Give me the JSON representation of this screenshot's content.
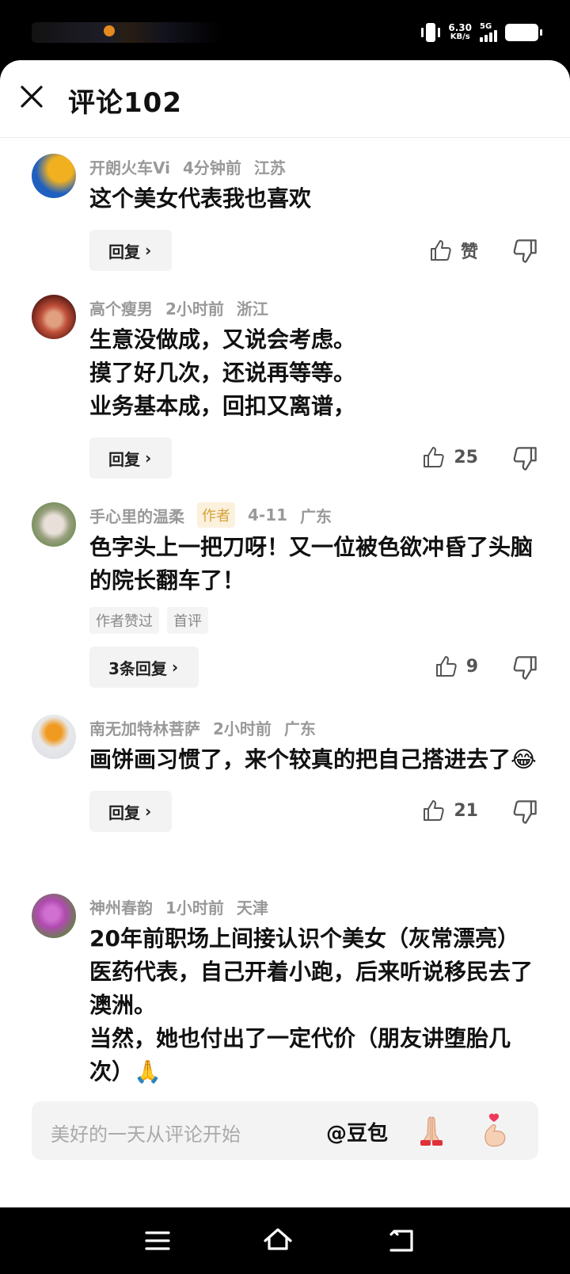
{
  "status_bar": {
    "net_speed": "6.30",
    "net_unit": "KB/s",
    "network": "5G"
  },
  "header": {
    "title": "评论102"
  },
  "comments": [
    {
      "name": "开朗火车Vi",
      "time": "4分钟前",
      "location": "江苏",
      "text": "这个美女代表我也喜欢",
      "reply_label": "回复",
      "likes": "赞",
      "avatar_colors": [
        "#1f5fc0",
        "#f0b020"
      ]
    },
    {
      "name": "高个瘦男",
      "time": "2小时前",
      "location": "浙江",
      "text": "生意没做成，又说会考虑。\n摸了好几次，还说再等等。\n业务基本成，回扣又离谱，",
      "reply_label": "回复",
      "likes": "25",
      "avatar_colors": [
        "#5a1a14",
        "#c0503a"
      ]
    },
    {
      "name": "手心里的温柔",
      "author_tag": "作者",
      "time": "4-11",
      "location": "广东",
      "text": "色字头上一把刀呀！又一位被色欲冲昏了头脑的院长翻车了！",
      "tags": [
        "作者赞过",
        "首评"
      ],
      "reply_label": "3条回复",
      "likes": "9",
      "avatar_colors": [
        "#6a8a50",
        "#e8e0d8"
      ]
    },
    {
      "name": "南无加特林菩萨",
      "time": "2小时前",
      "location": "广东",
      "text": "画饼画习惯了，来个较真的把自己搭进去了",
      "emoji": "😂",
      "reply_label": "回复",
      "likes": "21",
      "avatar_colors": [
        "#e0e4ea",
        "#f09a20"
      ]
    },
    {
      "name": "神州春韵",
      "time": "1小时前",
      "location": "天津",
      "text": "20年前职场上间接认识个美女（灰常漂亮）医药代表，自己开着小跑，后来听说移民去了澳洲。\n当然，她也付出了一定代价（朋友讲堕胎几次）",
      "emoji": "🙏",
      "avatar_colors": [
        "#5a8a3a",
        "#b04ab0"
      ]
    }
  ],
  "input": {
    "placeholder": "美好的一天从评论开始",
    "mention": "@豆包"
  },
  "colors": {
    "author_tag_bg": "#fbf1dd",
    "author_tag_text": "#d6a23a",
    "meta_text": "#999999"
  }
}
